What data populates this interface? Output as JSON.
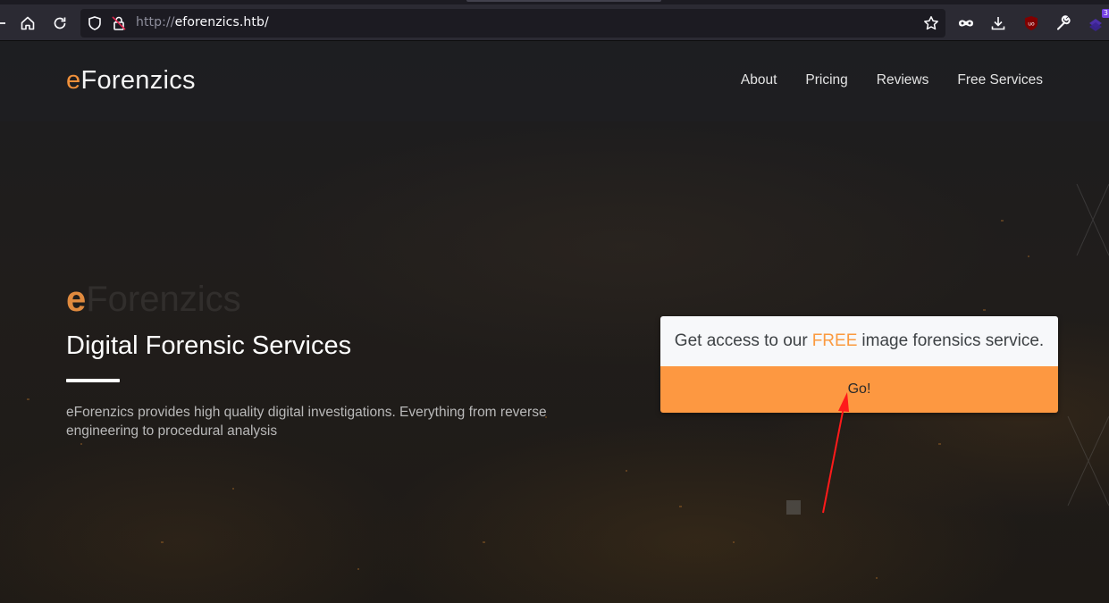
{
  "browser": {
    "url_protocol": "http://",
    "url_host": "eforenzics.htb/",
    "toolbar_icons": [
      "back-icon",
      "home-icon",
      "reload-icon",
      "shield-icon",
      "insecure-lock-icon",
      "bookmark-star-icon",
      "incognito-mask-icon",
      "download-icon",
      "ublock-origin-icon",
      "wrench-icon",
      "extension-icon"
    ],
    "extension_badge": "3"
  },
  "navbar": {
    "brand_accent": "e",
    "brand_rest": "Forenzics",
    "links": [
      {
        "label": "About"
      },
      {
        "label": "Pricing"
      },
      {
        "label": "Reviews"
      },
      {
        "label": "Free Services"
      }
    ]
  },
  "hero": {
    "logo_accent": "e",
    "logo_rest": "Forenzics",
    "title": "Digital Forensic Services",
    "description": "eForenzics provides high quality digital investigations. Everything from reverse engineering to procedural analysis"
  },
  "cta": {
    "text_before": "Get access to our",
    "text_highlight": "FREE",
    "text_after": "image forensics service.",
    "button_label": "Go!"
  },
  "colors": {
    "accent": "#f0903a",
    "button": "#fd9841",
    "annotation": "#ff0000"
  }
}
